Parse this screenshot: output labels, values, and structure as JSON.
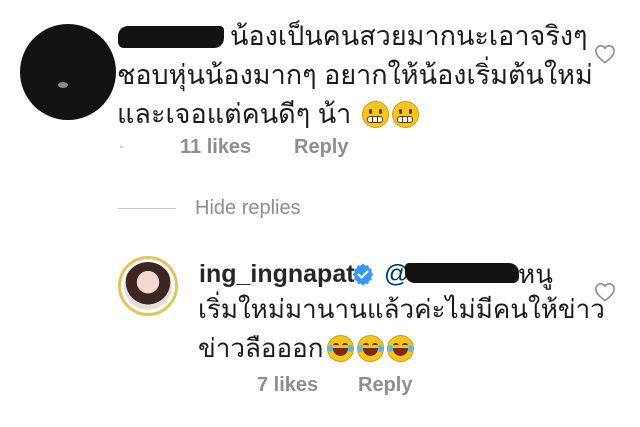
{
  "comment": {
    "text_line1": "น้องเป็นคนสวยมากนะเอาจริงๆ",
    "text_line2": "ชอบหุ่นน้องมากๆ  อยากให้น้องเริ่มต้นใหม่",
    "text_line3": "และเจอแต่คนดีๆ น้า",
    "emojis": [
      "grimacing-face",
      "grimacing-face"
    ],
    "likes": "11 likes",
    "reply_label": "Reply"
  },
  "hide_replies": "Hide replies",
  "reply": {
    "username": "ing_ingnapat",
    "mention_prefix": "@",
    "text_line1_tail": "หนู",
    "text_line2": "เริ่มใหม่มานานแล้วค่ะไม่มีคนให้ข่าว",
    "text_line3": "ข่าวลือออก",
    "emojis": [
      "face-with-tears-of-joy",
      "face-with-tears-of-joy",
      "face-with-tears-of-joy"
    ],
    "likes": "7 likes",
    "reply_label": "Reply"
  },
  "colors": {
    "text": "#262626",
    "meta": "#8e8e8e",
    "verified": "#3897f0",
    "mention": "#00376b"
  },
  "icons": {
    "like": "heart-outline-icon",
    "verified": "verified-badge-icon"
  }
}
